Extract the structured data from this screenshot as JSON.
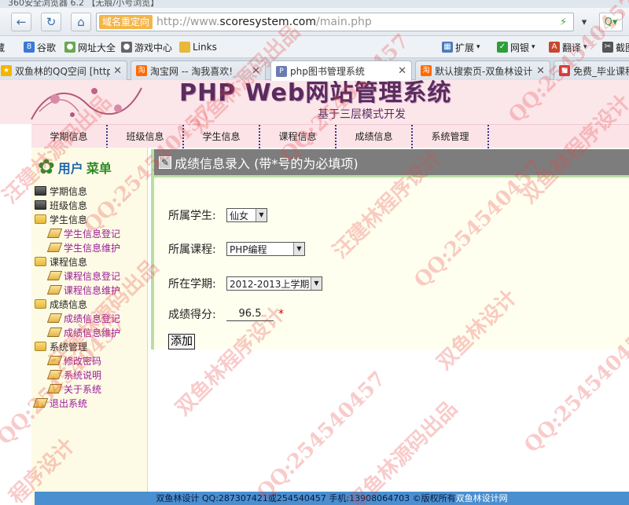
{
  "browser": {
    "window_title": "360安全浏览器 6.2 【无痕/小号浏览】",
    "address": {
      "redirect_label": "域名重定向",
      "url_prefix": "http://www.",
      "url_domain": "scoresystem.com",
      "url_path": "/main.php"
    },
    "bookmarks": [
      {
        "label": "藏",
        "icon": "favorites-icon",
        "color": "#e8b838"
      },
      {
        "label": "谷歌",
        "icon": "google-icon",
        "color": "#3b78d8"
      },
      {
        "label": "网址大全",
        "icon": "sites-icon",
        "color": "#6aa84f"
      },
      {
        "label": "游戏中心",
        "icon": "gamepad-icon",
        "color": "#666666"
      },
      {
        "label": "Links",
        "icon": "folder-icon",
        "color": "#e8b838"
      }
    ],
    "right_tools": [
      {
        "label": "扩展",
        "icon": "extension-icon"
      },
      {
        "label": "网银",
        "icon": "bank-shield-icon"
      },
      {
        "label": "翻译",
        "icon": "translate-icon"
      },
      {
        "label": "截图",
        "icon": "screenshot-icon"
      }
    ],
    "tabs": [
      {
        "label": "双鱼林的QQ空间 [http:",
        "icon": "star-icon",
        "color": "#f4b400",
        "active": false
      },
      {
        "label": "淘宝网 -- 淘我喜欢!",
        "icon": "taobao-icon",
        "color": "#ff6a00",
        "active": false
      },
      {
        "label": "php图书管理系统",
        "icon": "pma-icon",
        "color": "#6c7bb5",
        "active": true
      },
      {
        "label": "默认搜索页-双鱼林设计:",
        "icon": "taobao-icon",
        "color": "#ff6a00",
        "active": false
      },
      {
        "label": "免费_毕业课程",
        "icon": "red-icon",
        "color": "#d83a3a",
        "active": false
      }
    ]
  },
  "site": {
    "title": "PHP Web网站管理系统",
    "subtitle": "基于三层模式开发",
    "nav": [
      "学期信息",
      "班级信息",
      "学生信息",
      "课程信息",
      "成绩信息",
      "系统管理"
    ]
  },
  "sidebar": {
    "menu_title_a": "用户",
    "menu_title_b": "菜单",
    "items": [
      {
        "label": "学期信息",
        "type": "top",
        "icon": "book-icon"
      },
      {
        "label": "班级信息",
        "type": "top",
        "icon": "book-icon"
      },
      {
        "label": "学生信息",
        "type": "top",
        "icon": "folder-icon"
      },
      {
        "label": "学生信息登记",
        "type": "sub",
        "icon": "document-icon"
      },
      {
        "label": "学生信息维护",
        "type": "sub",
        "icon": "document-icon"
      },
      {
        "label": "课程信息",
        "type": "top",
        "icon": "folder-icon"
      },
      {
        "label": "课程信息登记",
        "type": "sub",
        "icon": "document-icon"
      },
      {
        "label": "课程信息维护",
        "type": "sub",
        "icon": "document-icon"
      },
      {
        "label": "成绩信息",
        "type": "top",
        "icon": "folder-icon"
      },
      {
        "label": "成绩信息登记",
        "type": "sub",
        "icon": "document-icon"
      },
      {
        "label": "成绩信息维护",
        "type": "sub",
        "icon": "document-icon"
      },
      {
        "label": "系统管理",
        "type": "top",
        "icon": "folder-icon"
      },
      {
        "label": "修改密码",
        "type": "sub",
        "icon": "document-icon"
      },
      {
        "label": "系统说明",
        "type": "sub",
        "icon": "document-icon"
      },
      {
        "label": "关于系统",
        "type": "sub",
        "icon": "document-icon"
      },
      {
        "label": "退出系统",
        "type": "exit",
        "icon": "document-icon"
      }
    ]
  },
  "form": {
    "title": "成绩信息录入 (带*号的为必填项)",
    "student_label": "所属学生:",
    "student_value": "仙女",
    "course_label": "所属课程:",
    "course_value": "PHP编程",
    "term_label": "所在学期:",
    "term_value": "2012-2013上学期",
    "score_label": "成绩得分:",
    "score_value": "96.5",
    "required_mark": "*",
    "submit_label": "添加"
  },
  "footer": {
    "text": "双鱼林设计 QQ:287307421或254540457 手机:13908064703 ©版权所有",
    "link": "双鱼林设计网"
  },
  "watermarks": [
    "汪建林源码出品",
    "QQ:254540457",
    "双鱼林源码出品",
    "QQ:254540457",
    "汪建林程序设计",
    "QQ:254540457",
    "双鱼林程序设计",
    "QQ:254540457",
    "汪建林源码出品",
    "双鱼林程序设计",
    "QQ:254540457",
    "双鱼林设计",
    "QQ:254540457",
    "双鱼林源码出品",
    "程序设计",
    "QQ:254540457"
  ]
}
